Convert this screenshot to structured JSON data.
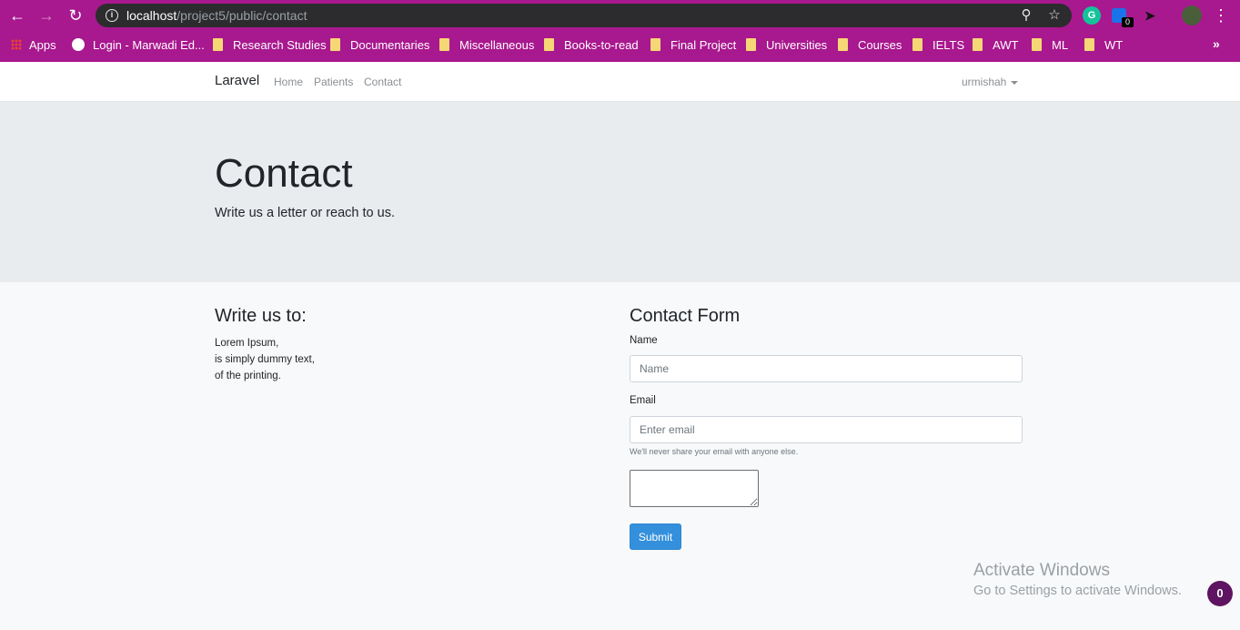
{
  "browser": {
    "url_host": "localhost",
    "url_path": "/project5/public/contact",
    "extension_badge": "0",
    "grammarly_letter": "G",
    "bookmarks_more": "»",
    "bookmarks": [
      {
        "label": "Apps",
        "icon": "apps-grid-icon"
      },
      {
        "label": "Login - Marwadi Ed...",
        "icon": "globe-icon"
      },
      {
        "label": "Research Studies",
        "icon": "folder-icon"
      },
      {
        "label": "Documentaries",
        "icon": "folder-icon"
      },
      {
        "label": "Miscellaneous",
        "icon": "folder-icon"
      },
      {
        "label": "Books-to-read",
        "icon": "folder-icon"
      },
      {
        "label": "Final Project",
        "icon": "folder-icon"
      },
      {
        "label": "Universities",
        "icon": "folder-icon"
      },
      {
        "label": "Courses",
        "icon": "folder-icon"
      },
      {
        "label": "IELTS",
        "icon": "folder-icon"
      },
      {
        "label": "AWT",
        "icon": "folder-icon"
      },
      {
        "label": "ML",
        "icon": "folder-icon"
      },
      {
        "label": "WT",
        "icon": "folder-icon"
      }
    ],
    "colors": {
      "frame": "#a8188e",
      "omnibox": "#2c2c2e",
      "folder": "#f6d775"
    }
  },
  "navbar": {
    "brand": "Laravel",
    "links": [
      "Home",
      "Patients",
      "Contact"
    ],
    "user": "urmishah"
  },
  "jumbotron": {
    "title": "Contact",
    "lead": "Write us a letter or reach to us."
  },
  "address": {
    "title": "Write us to:",
    "lines": [
      "Lorem Ipsum,",
      "is simply dummy text,",
      "of the printing."
    ]
  },
  "form": {
    "title": "Contact Form",
    "name_label": "Name",
    "name_placeholder": "Name",
    "email_label": "Email",
    "email_placeholder": "Enter email",
    "email_help": "We'll never share your email with anyone else.",
    "submit_label": "Submit",
    "colors": {
      "primary": "#3490dc"
    }
  },
  "overlay": {
    "activate_title": "Activate Windows",
    "activate_text": "Go to Settings to activate Windows.",
    "badge_count": "0"
  }
}
